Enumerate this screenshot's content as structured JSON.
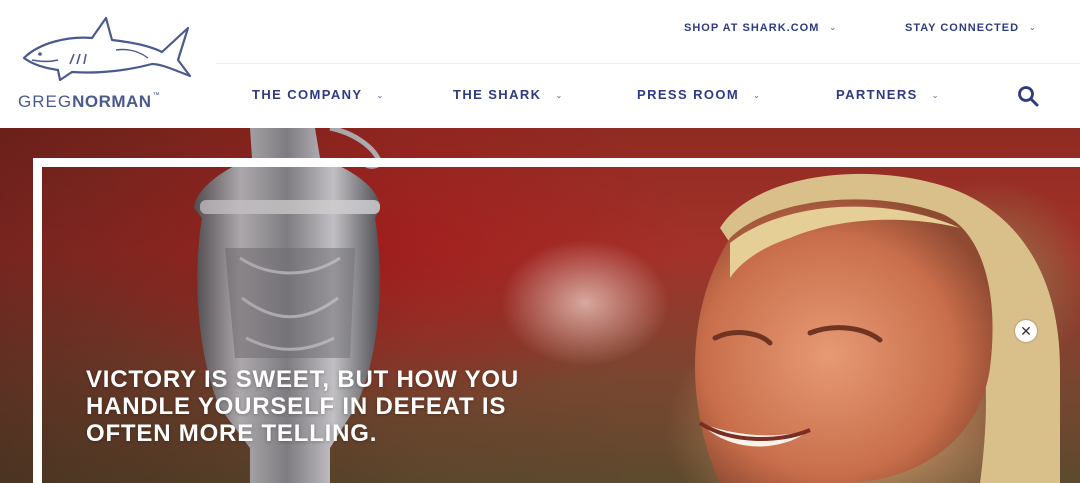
{
  "brand": {
    "name_light": "GREG",
    "name_bold": "NORMAN",
    "trademark": "™",
    "color": "#4a5a8e"
  },
  "top_nav": [
    {
      "label": "SHOP AT SHARK.COM",
      "icon": "chevron-down-icon"
    },
    {
      "label": "STAY CONNECTED",
      "icon": "chevron-down-icon"
    }
  ],
  "main_nav": [
    {
      "label": "THE COMPANY",
      "icon": "chevron-down-icon"
    },
    {
      "label": "THE SHARK",
      "icon": "chevron-down-icon"
    },
    {
      "label": "PRESS ROOM",
      "icon": "chevron-down-icon"
    },
    {
      "label": "PARTNERS",
      "icon": "chevron-down-icon"
    }
  ],
  "search": {
    "icon": "search-icon"
  },
  "hero": {
    "quote": "VICTORY IS SWEET, BUT HOW YOU HANDLE YOURSELF IN DEFEAT IS OFTEN MORE TELLING.",
    "close_icon": "close-icon",
    "close_glyph": "✕"
  },
  "colors": {
    "nav_text": "#2e3b83",
    "background": "#ffffff"
  }
}
